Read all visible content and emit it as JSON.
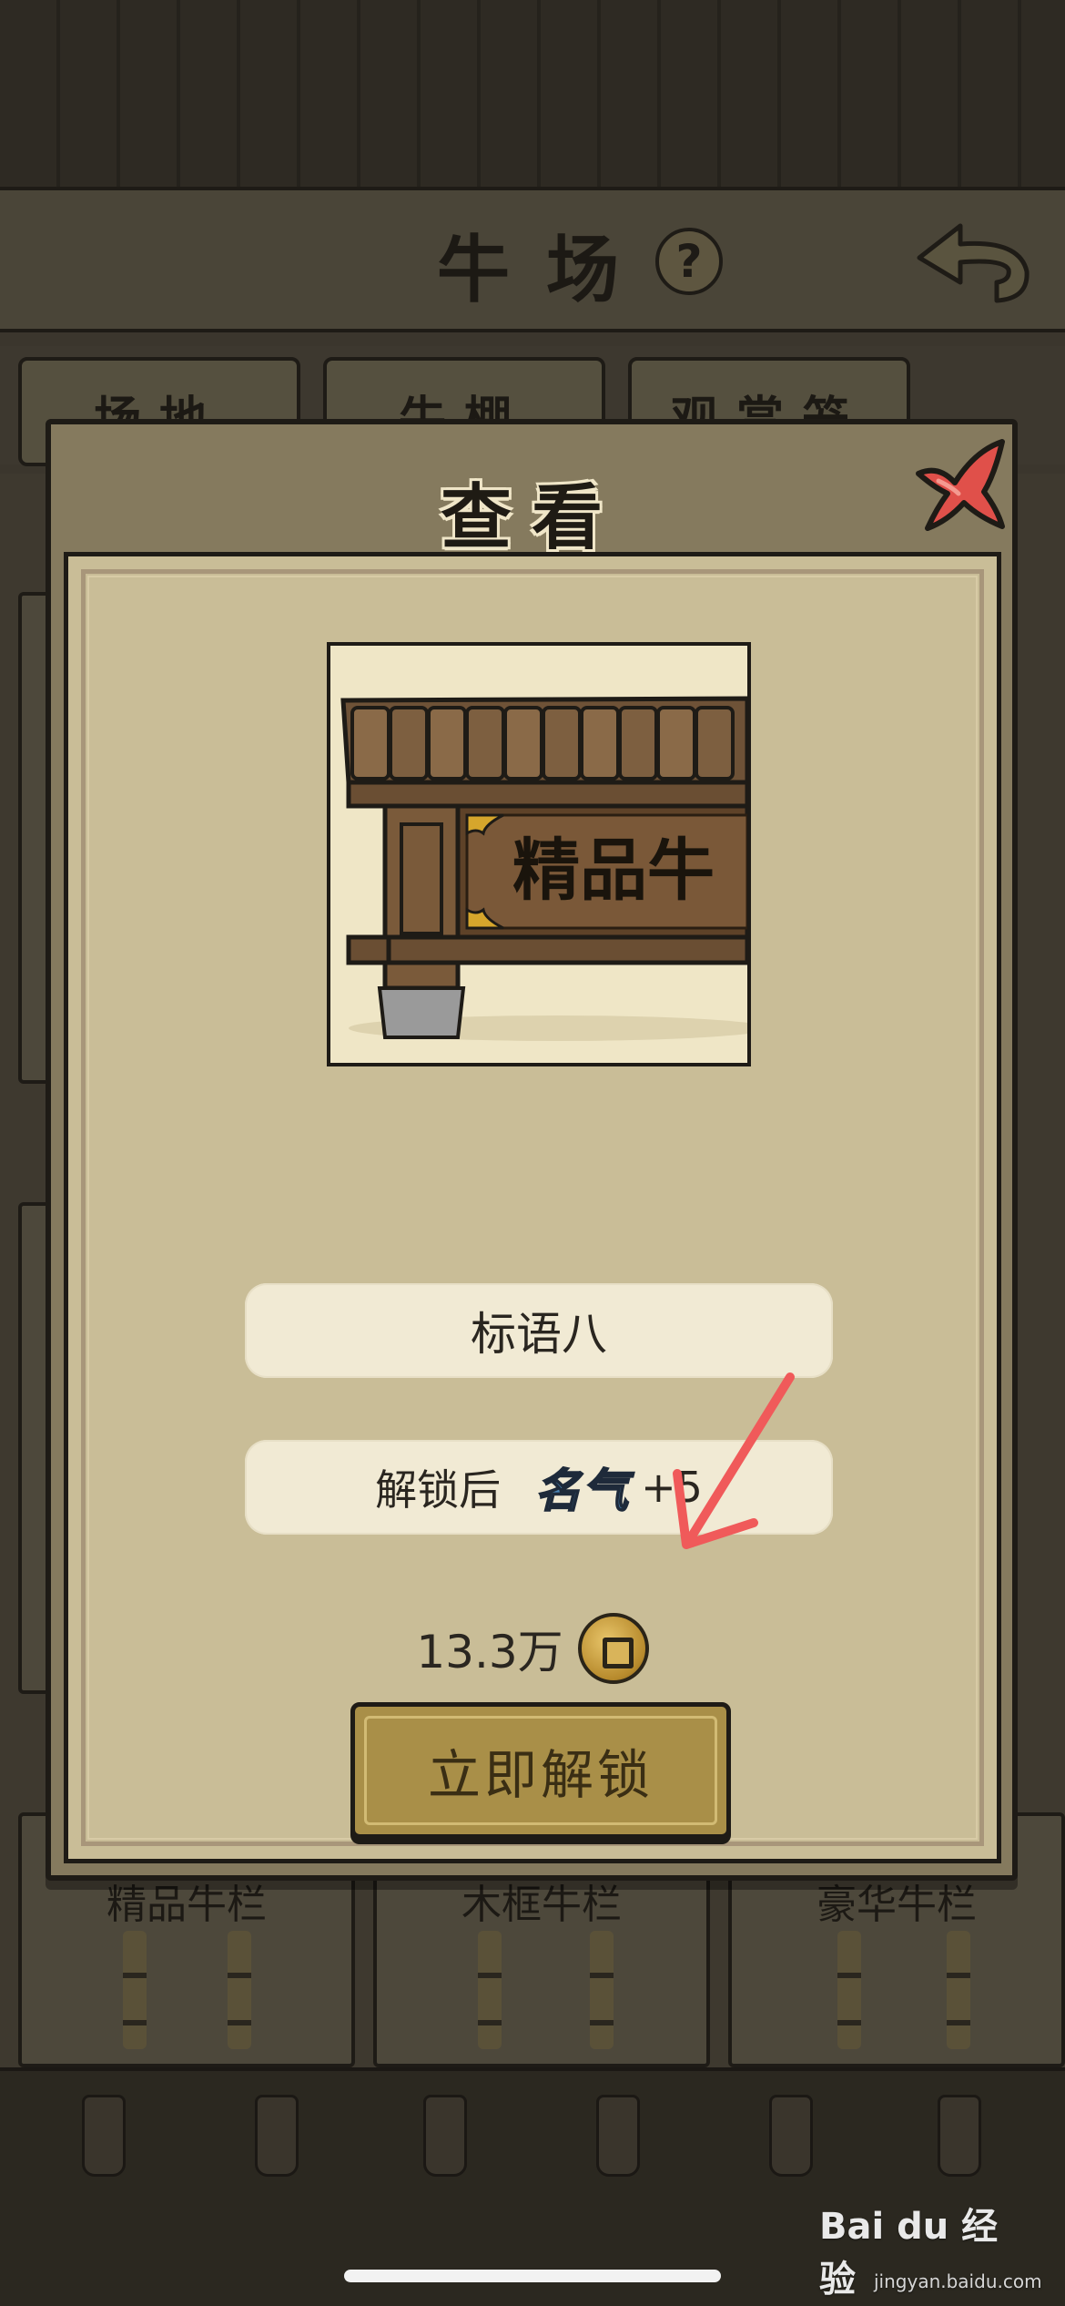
{
  "background": {
    "screen_title": "牛场",
    "help_glyph": "?",
    "tabs": [
      "场地",
      "牛棚",
      "观赏笼"
    ],
    "cards": [
      "精品牛栏",
      "木框牛栏",
      "豪华牛栏"
    ]
  },
  "modal": {
    "title": "查看",
    "item_name": "标语八",
    "sign_text": "精品牛",
    "effect_prefix": "解锁后",
    "effect_stat": "名气",
    "effect_value": "+5",
    "price": "13.3万",
    "unlock_label": "立即解锁"
  },
  "watermark": {
    "brand": "Bai du 经验",
    "url": "jingyan.baidu.com"
  },
  "icons": {
    "close": "close-icon",
    "coin": "copper-coin-icon",
    "back": "back-arrow-icon",
    "help": "help-icon",
    "annotation": "red-arrow-icon"
  },
  "colors": {
    "panel_bg": "#c9bd97",
    "pill_bg": "#f1ead4",
    "button_bg": "#a98f48",
    "close_red": "#e0504a",
    "annotation_red": "#f05a5a"
  }
}
